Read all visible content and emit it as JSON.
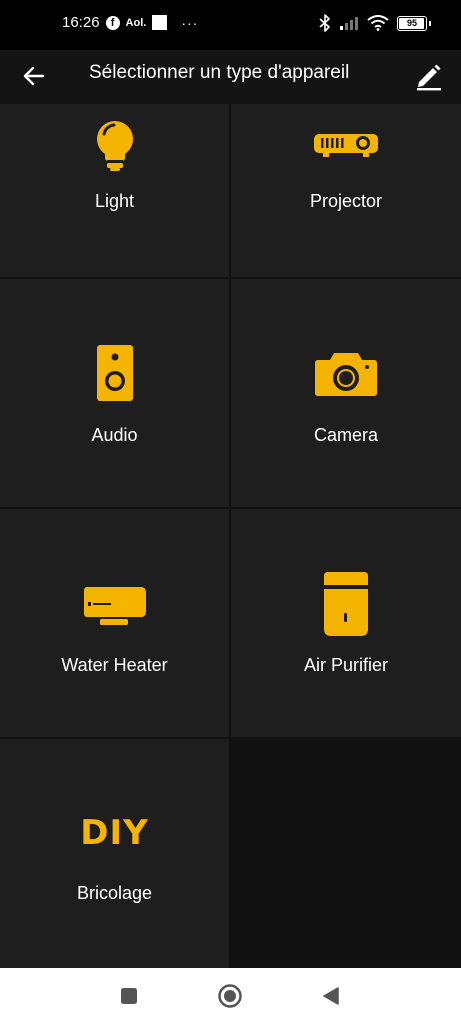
{
  "status_bar": {
    "time": "16:26",
    "aol": "Aol.",
    "more": "···",
    "battery": "95",
    "battery_level": 0.95
  },
  "header": {
    "title": "Sélectionner un type d'appareil",
    "back_icon": "arrow-left-icon",
    "edit_icon": "pencil-icon"
  },
  "device_types": [
    {
      "label": "Light",
      "icon": "light-bulb-icon"
    },
    {
      "label": "Projector",
      "icon": "projector-icon"
    },
    {
      "label": "Audio",
      "icon": "speaker-icon"
    },
    {
      "label": "Camera",
      "icon": "camera-icon"
    },
    {
      "label": "Water Heater",
      "icon": "water-heater-icon"
    },
    {
      "label": "Air Purifier",
      "icon": "air-purifier-icon"
    },
    {
      "label": "Bricolage",
      "icon": "diy-icon",
      "icon_text": "DIY"
    }
  ],
  "colors": {
    "accent": "#F5B400",
    "tile_background": "#1E1E1E",
    "header_background": "#141414"
  }
}
